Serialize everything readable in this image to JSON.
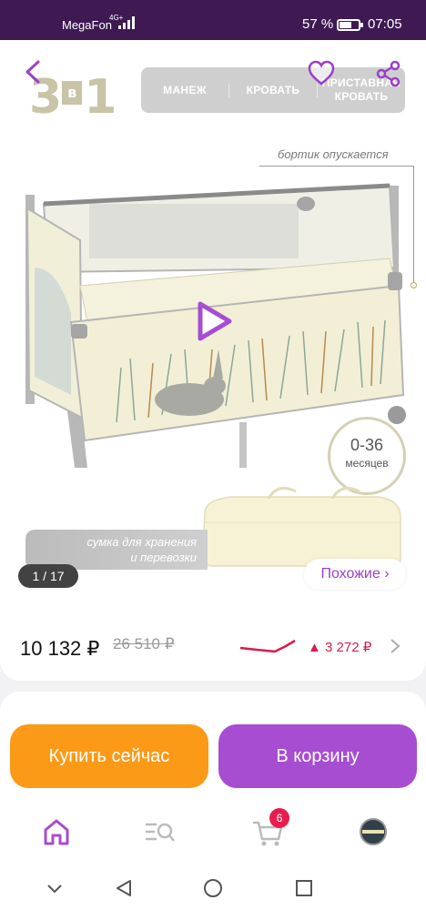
{
  "status_bar": {
    "carrier": "MegaFon",
    "network": "4G+",
    "battery_percent": "57 %",
    "time": "07:05"
  },
  "product_image": {
    "logo_text": "3",
    "logo_in": "в",
    "logo_one": "1",
    "modes": [
      "МАНЕЖ",
      "КРОВАТЬ",
      "ПРИСТАВНАЯ КРОВАТЬ"
    ],
    "annotation_side": "бортик опускается",
    "age_value": "0-36",
    "age_unit": "месяцев",
    "bag_label_line1": "сумка для хранения",
    "bag_label_line2": "и перевозки",
    "counter": "1 / 17",
    "similar_label": "Похожие ›"
  },
  "pricing": {
    "price": "10 132 ₽",
    "old_price": "26 510 ₽",
    "delta": "▲ 3 272 ₽",
    "trend_color": "#d81b4d"
  },
  "actions": {
    "buy_now": "Купить сейчас",
    "add_to_cart": "В корзину"
  },
  "tabbar": {
    "items": [
      "home-icon",
      "catalog-search-icon",
      "cart-icon",
      "profile-icon"
    ],
    "cart_count": "6"
  },
  "colors": {
    "brand_purple": "#a74dd2",
    "buy_orange": "#fa9a17",
    "status_bar": "#3f1a52"
  }
}
